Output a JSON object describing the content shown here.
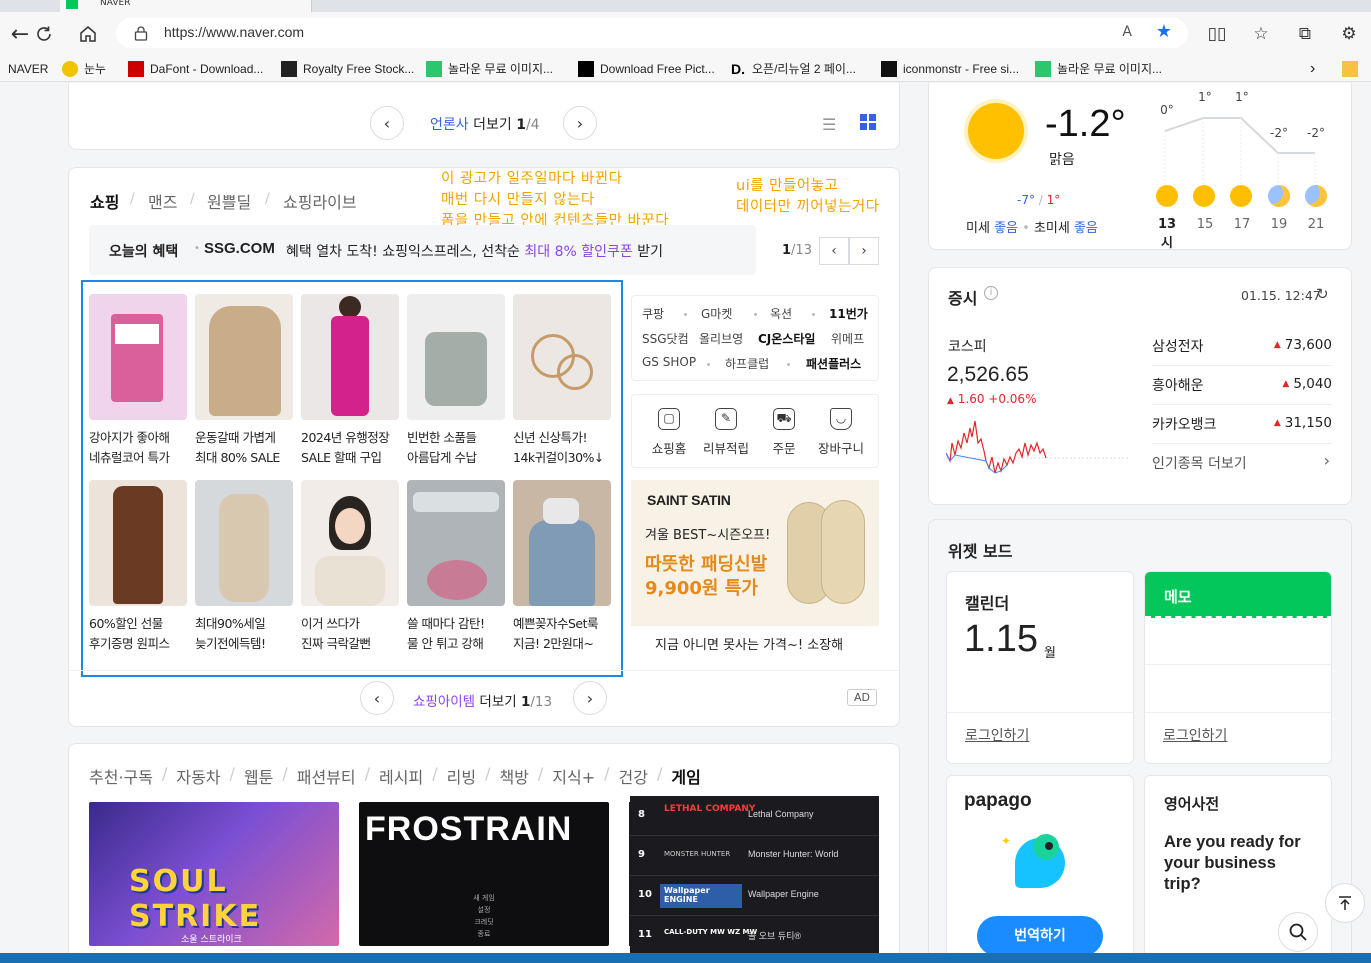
{
  "browser": {
    "tab_title": "NAVER",
    "url": "https://www.naver.com",
    "read_aloud_icon": "A",
    "bookmarks": [
      {
        "label": "NAVER",
        "icon": "naver"
      },
      {
        "label": "눈누",
        "icon": "noonnu"
      },
      {
        "label": "DaFont - Download...",
        "icon": "dafont"
      },
      {
        "label": "Royalty Free Stock...",
        "icon": "gettyimages"
      },
      {
        "label": "놀라운 무료 이미지...",
        "icon": "pixabay"
      },
      {
        "label": "Download Free Pict...",
        "icon": "unsplash"
      },
      {
        "label": "오픈/리뉴얼 2 페이...",
        "icon": "d-logo"
      },
      {
        "label": "iconmonstr - Free si...",
        "icon": "iconmonstr"
      },
      {
        "label": "놀라운 무료 이미지...",
        "icon": "pixabay"
      }
    ]
  },
  "news_pager": {
    "label": "언론사",
    "more": "더보기",
    "current": "1",
    "total": "/4"
  },
  "annotations": {
    "left": [
      "이 광고가 일주일마다 바뀐다",
      "매번 다시 만들지 않는다",
      "폼을 만들고 안에 컨텐츠들만 바꾼다"
    ],
    "right": [
      "ui를 만들어놓고",
      "데이터만 끼어넣는거다"
    ]
  },
  "shopping": {
    "tabs": [
      "쇼핑",
      "맨즈",
      "원쁠딜",
      "쇼핑라이브"
    ],
    "benefit_label": "오늘의 혜택",
    "benefit_brand": "SSG.COM",
    "benefit_text": "혜택 열차 도착! 쇼핑익스프레스, 선착순",
    "benefit_highlight": "최대 8% 할인쿠폰",
    "benefit_suffix": "받기",
    "benefit_page": "1",
    "benefit_total": "/13",
    "products": [
      {
        "line1": "강아지가 좋아해",
        "line2": "네츄럴코어 특가"
      },
      {
        "line1": "운동갈때 가볍게",
        "line2": "최대 80% SALE"
      },
      {
        "line1": "2024년 유행정장",
        "line2": "SALE 할때 구입"
      },
      {
        "line1": "빈번한 소품들",
        "line2": "아름답게 수납"
      },
      {
        "line1": "신년 신상특가!",
        "line2": "14k귀걸이30%↓"
      },
      {
        "line1": "60%할인 선물",
        "line2": "후기증명 원피스"
      },
      {
        "line1": "최대90%세일",
        "line2": "늦기전에득템!"
      },
      {
        "line1": "이거 쓰다가",
        "line2": "진짜 극락갈뻔"
      },
      {
        "line1": "쓸 때마다 감탄!",
        "line2": "물 안 튀고 강해"
      },
      {
        "line1": "예쁜꽂자수Set룩",
        "line2": "지금! 2만원대~"
      }
    ],
    "malls": [
      "쿠팡",
      "G마켓",
      "옥션",
      "11번가",
      "SSG닷컴",
      "올리브영",
      "CJ온스타일",
      "위메프",
      "GS SHOP",
      "하프클럽",
      "패션플러스"
    ],
    "quick": [
      "쇼핑홈",
      "리뷰적립",
      "주문",
      "장바구니"
    ],
    "banner": {
      "brand": "SAINT SATIN",
      "line1": "겨울 BEST~시즌오프!",
      "line2": "따뜻한 패딩신발",
      "line3": "9,900원 특가",
      "caption": "지금 아니면 못사는 가격~! 소장해"
    },
    "pager_label": "쇼핑아이템",
    "pager_more": "더보기",
    "pager_current": "1",
    "pager_total": "/13",
    "ad_badge": "AD"
  },
  "content_tabs": [
    "추천·구독",
    "자동차",
    "웹툰",
    "패션뷰티",
    "레시피",
    "리빙",
    "책방",
    "지식+",
    "건강",
    "게임"
  ],
  "games": {
    "card1_title": "SOUL STRIKE",
    "card1_sub": "소울 스트라이크",
    "card2_title": "FROSTRAIN",
    "card2_menu": [
      "새 게임",
      "설정",
      "크레딧",
      "종료"
    ],
    "ranking": [
      {
        "rank": "8",
        "logo": "LETHAL COMPANY",
        "name": "Lethal Company"
      },
      {
        "rank": "9",
        "logo": "MONSTER HUNTER",
        "name": "Monster Hunter: World"
      },
      {
        "rank": "10",
        "logo": "Wallpaper ENGINE",
        "name": "Wallpaper Engine"
      },
      {
        "rank": "11",
        "logo": "CALL-DUTY MW WZ MW",
        "name": "콜 오브 듀티®"
      }
    ]
  },
  "weather": {
    "temp": "-1.2°",
    "condition": "맑음",
    "low": "-7°",
    "high": "1°",
    "fine_dust_label": "미세",
    "fine_dust_value": "좋음",
    "ultra_dust_label": "초미세",
    "ultra_dust_value": "좋음",
    "forecast": [
      {
        "time": "13시",
        "temp": "0°",
        "icon": "sun-icon"
      },
      {
        "time": "15",
        "temp": "1°",
        "icon": "sun-icon"
      },
      {
        "time": "17",
        "temp": "1°",
        "icon": "sun-icon"
      },
      {
        "time": "19",
        "temp": "-2°",
        "icon": "moon-icon"
      },
      {
        "time": "21",
        "temp": "-2°",
        "icon": "moon-icon"
      }
    ]
  },
  "stocks": {
    "title": "증시",
    "date": "01.15. 12:47",
    "index_name": "코스피",
    "index_value": "2,526.65",
    "index_change": "1.60",
    "index_pct": "+0.06%",
    "list": [
      {
        "name": "삼성전자",
        "value": "73,600"
      },
      {
        "name": "흥아해운",
        "value": "5,040"
      },
      {
        "name": "카카오뱅크",
        "value": "31,150"
      }
    ],
    "more": "인기종목 더보기"
  },
  "widget": {
    "title": "위젯 보드",
    "calendar_title": "캘린더",
    "calendar_date": "1.15",
    "calendar_unit": "월",
    "calendar_login": "로그인하기",
    "memo_title": "메모",
    "memo_login": "로그인하기",
    "papago_title": "papago",
    "papago_button": "번역하기",
    "dict_title": "영어사전",
    "dict_text": "Are you ready for your business trip?"
  },
  "colors": {
    "naver_green": "#03c75a",
    "link_blue": "#3561e6",
    "annotation": "#f0a400",
    "selection_box": "#1e88e5",
    "shop_purple": "#8e44ec"
  }
}
